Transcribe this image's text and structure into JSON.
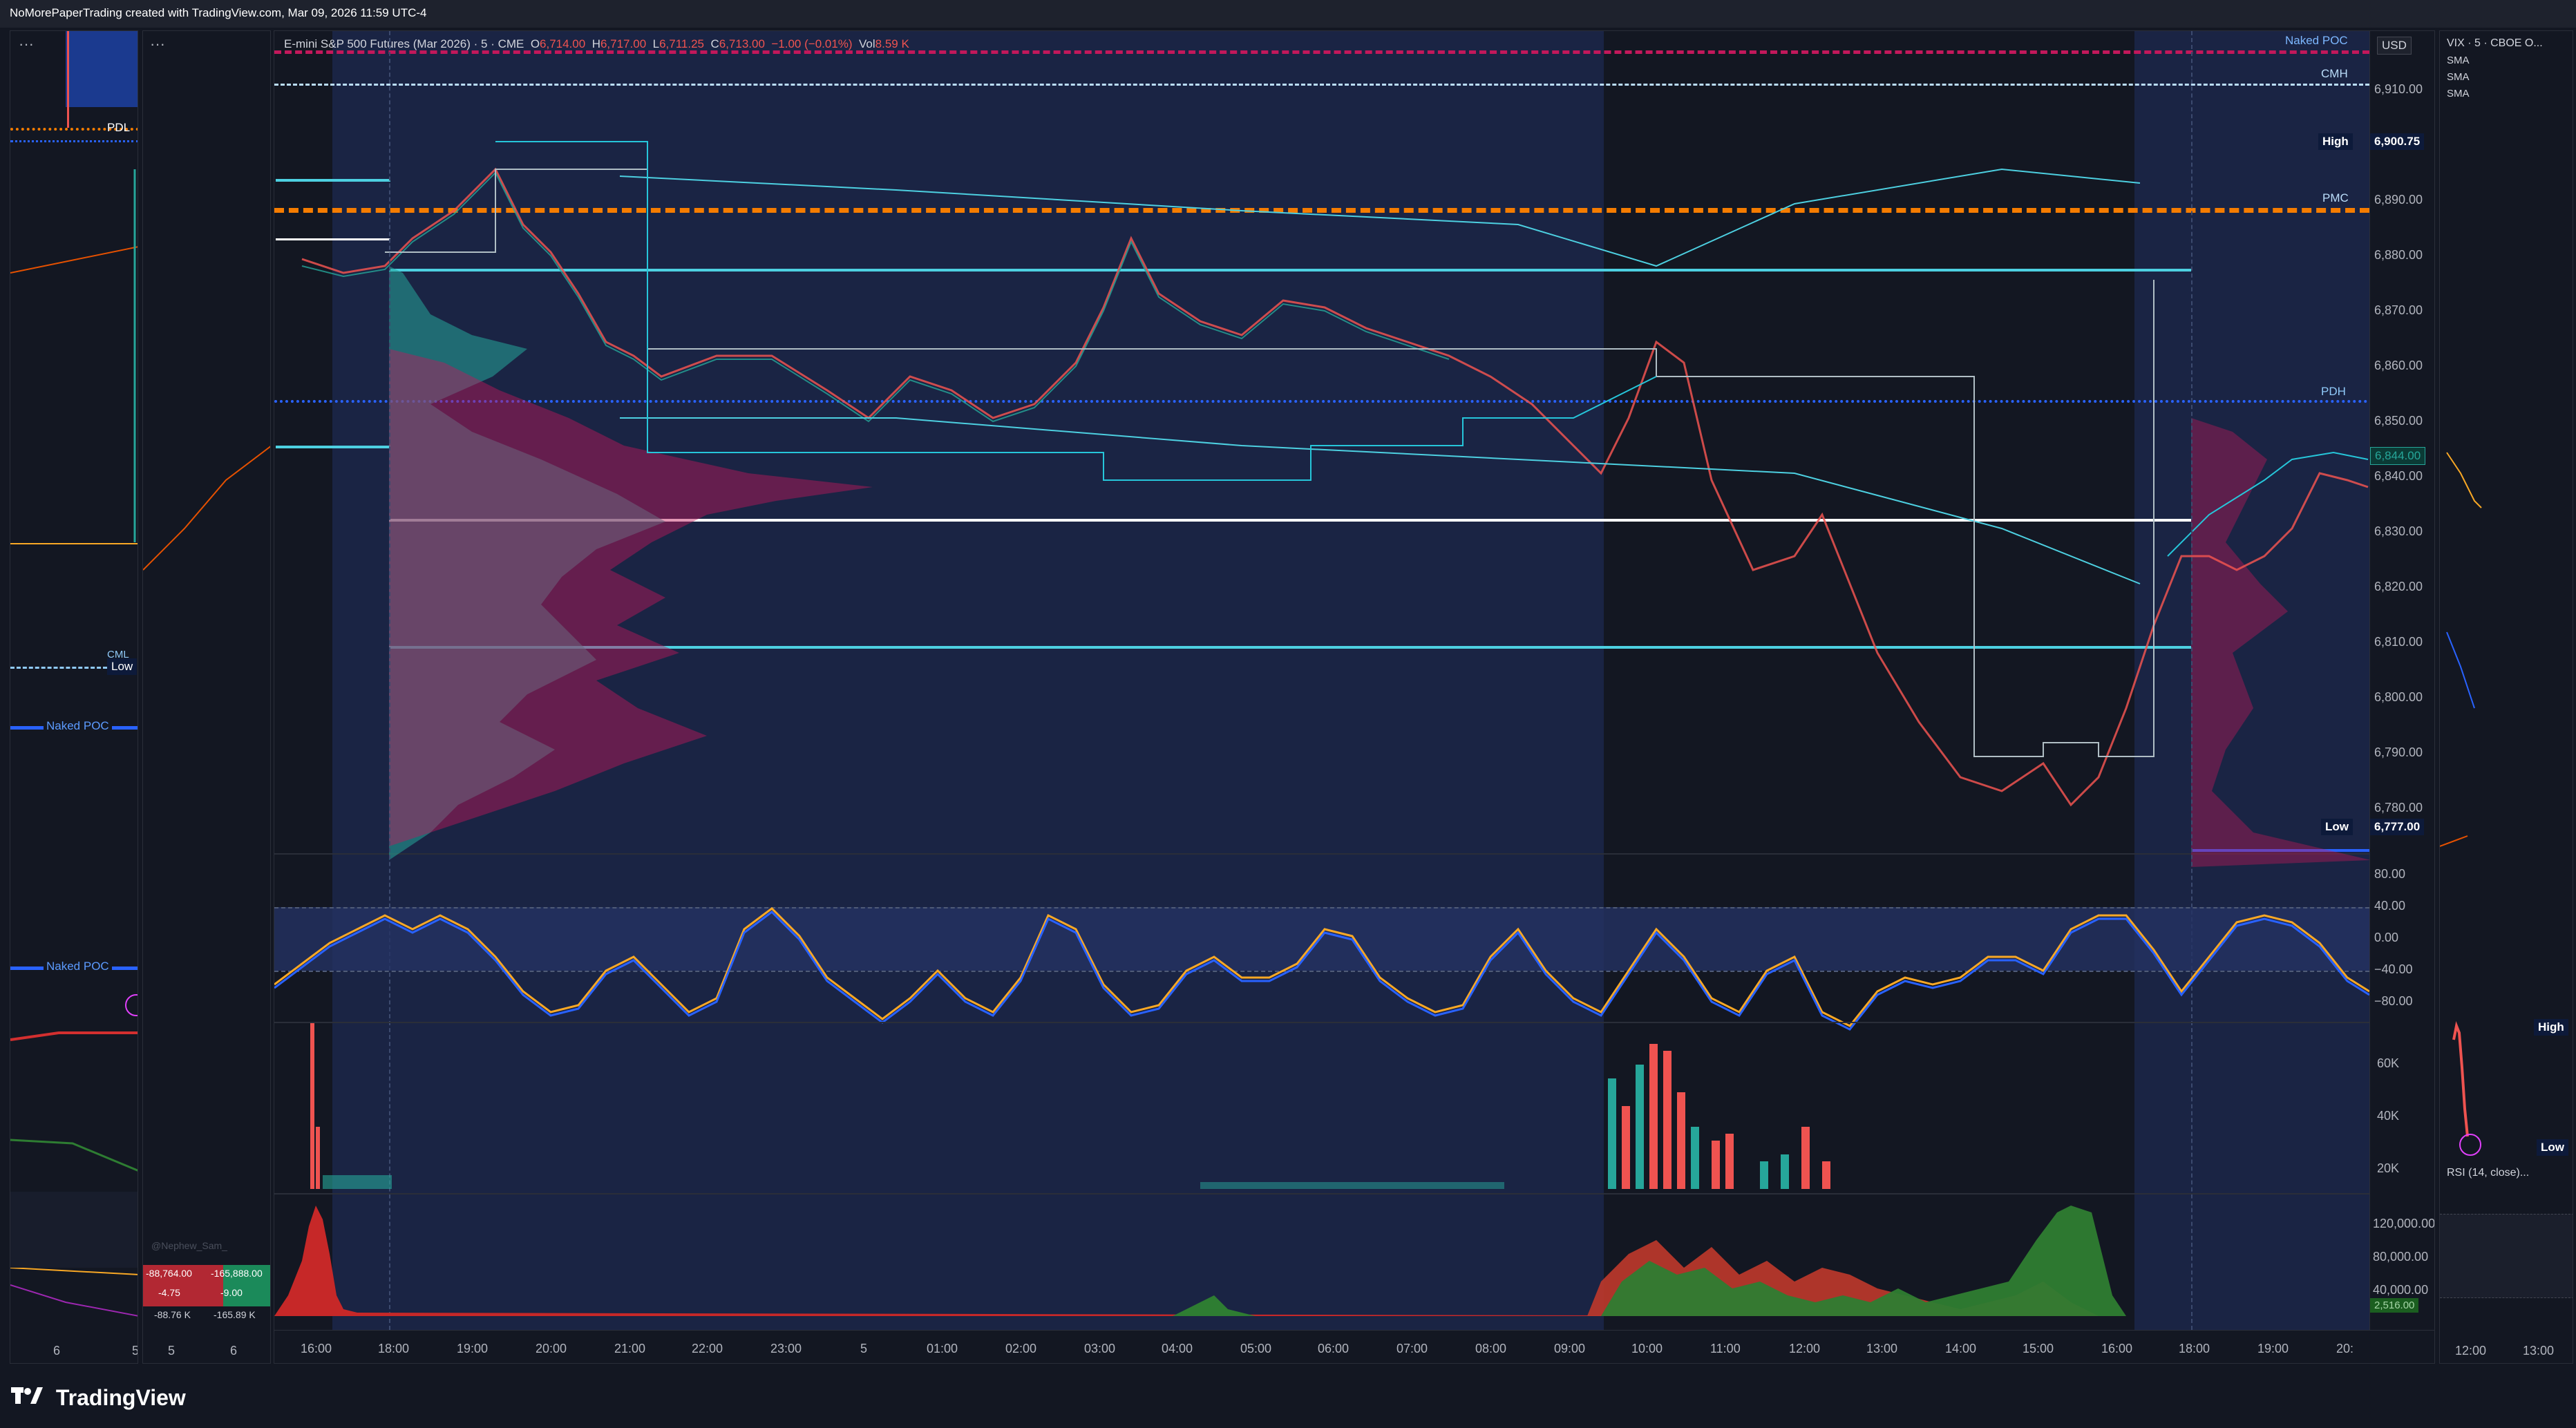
{
  "header": {
    "caption": "NoMorePaperTrading created with TradingView.com, Mar 09, 2026 11:59 UTC-4"
  },
  "left_mini": {
    "labels": {
      "pdl": "PDL",
      "cml": "CML",
      "low": "Low",
      "naked_poc_1": "Naked POC",
      "naked_poc_2": "Naked POC"
    },
    "axis": [
      "6",
      "5"
    ]
  },
  "mid_mini": {
    "watermark": "@Nephew_Sam_",
    "axis": [
      "5",
      "6"
    ],
    "table": [
      [
        "-88,764.00",
        "-165,888.00"
      ],
      [
        "-4.75",
        "-9.00"
      ],
      [
        "-88.76 K",
        "-165.89 K"
      ]
    ]
  },
  "main": {
    "symbol": "E-mini S&P 500 Futures (Mar 2026) · 5 · CME",
    "o_label": "O",
    "o": "6,714.00",
    "h_label": "H",
    "h": "6,717.00",
    "l_label": "L",
    "l": "6,711.25",
    "c_label": "C",
    "c": "6,713.00",
    "chg": "−1.00 (−0.01%)",
    "vol_label": "Vol",
    "vol": "8.59 K",
    "currency": "USD",
    "price_ticks": [
      "6,910.00",
      "6,890.00",
      "6,880.00",
      "6,870.00",
      "6,860.00",
      "6,850.00",
      "6,840.00",
      "6,830.00",
      "6,820.00",
      "6,810.00",
      "6,800.00",
      "6,790.00",
      "6,780.00"
    ],
    "level_labels": {
      "naked_poc": "Naked POC",
      "cmh": "CMH",
      "high": "High",
      "pmc": "PMC",
      "pdh": "PDH",
      "low": "Low"
    },
    "high_value": "6,900.75",
    "last_price": "6,844.00",
    "low_value": "6,777.00",
    "osc_ticks": [
      "80.00",
      "40.00",
      "0.00",
      "−40.00",
      "−80.00"
    ],
    "vol_ticks": [
      "60K",
      "40K",
      "20K"
    ],
    "cvd_ticks": [
      "120,000.00",
      "80,000.00",
      "40,000.00"
    ],
    "cvd_last": "2,516.00",
    "time_axis": [
      "16:00",
      "18:00",
      "19:00",
      "20:00",
      "21:00",
      "22:00",
      "23:00",
      "5",
      "01:00",
      "02:00",
      "03:00",
      "04:00",
      "05:00",
      "06:00",
      "07:00",
      "08:00",
      "09:00",
      "10:00",
      "11:00",
      "12:00",
      "13:00",
      "14:00",
      "15:00",
      "16:00",
      "18:00",
      "19:00",
      "20:"
    ]
  },
  "right_mini": {
    "title": "VIX · 5 · CBOE O...",
    "sma": [
      "SMA",
      "SMA",
      "SMA"
    ],
    "high": "High",
    "low": "Low",
    "rsi": "RSI (14, close)...",
    "axis": [
      "12:00",
      "13:00"
    ]
  },
  "brand": {
    "name": "TradingView"
  },
  "colors": {
    "bg": "#131722",
    "session_bg": "#1a2444",
    "cyan": "#4dd0e1",
    "orange": "#f57c00",
    "magenta": "#c2185b",
    "blue_level": "#2962ff",
    "up": "#26a69a",
    "down": "#ef5350"
  }
}
